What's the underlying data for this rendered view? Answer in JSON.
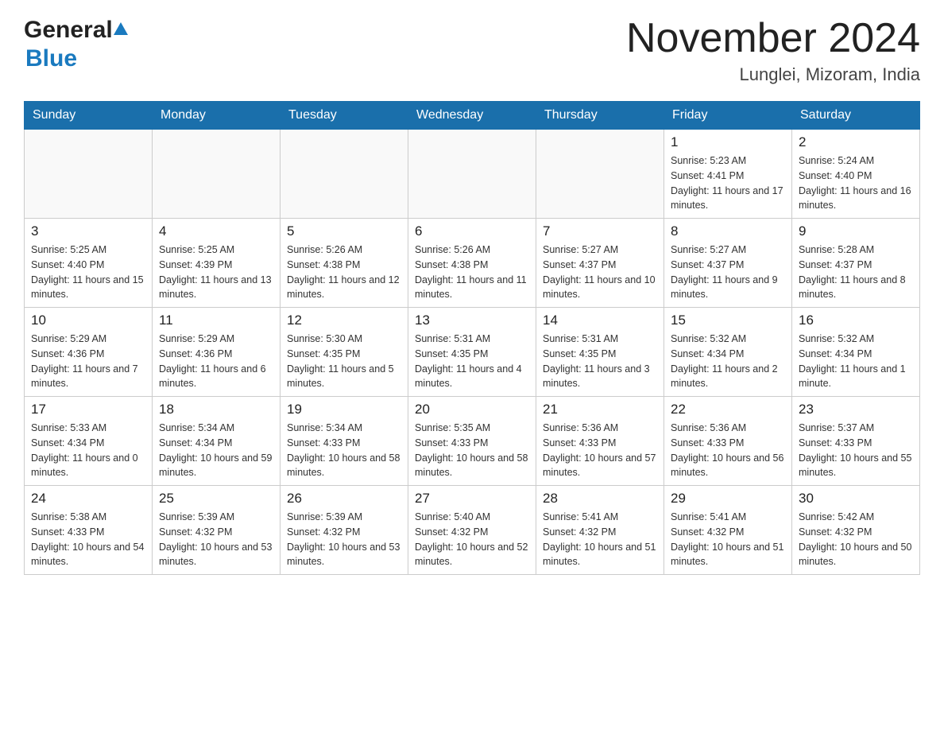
{
  "logo": {
    "general": "General",
    "blue": "Blue"
  },
  "header": {
    "month": "November 2024",
    "location": "Lunglei, Mizoram, India"
  },
  "days_of_week": [
    "Sunday",
    "Monday",
    "Tuesday",
    "Wednesday",
    "Thursday",
    "Friday",
    "Saturday"
  ],
  "weeks": [
    [
      {
        "day": "",
        "info": ""
      },
      {
        "day": "",
        "info": ""
      },
      {
        "day": "",
        "info": ""
      },
      {
        "day": "",
        "info": ""
      },
      {
        "day": "",
        "info": ""
      },
      {
        "day": "1",
        "info": "Sunrise: 5:23 AM\nSunset: 4:41 PM\nDaylight: 11 hours and 17 minutes."
      },
      {
        "day": "2",
        "info": "Sunrise: 5:24 AM\nSunset: 4:40 PM\nDaylight: 11 hours and 16 minutes."
      }
    ],
    [
      {
        "day": "3",
        "info": "Sunrise: 5:25 AM\nSunset: 4:40 PM\nDaylight: 11 hours and 15 minutes."
      },
      {
        "day": "4",
        "info": "Sunrise: 5:25 AM\nSunset: 4:39 PM\nDaylight: 11 hours and 13 minutes."
      },
      {
        "day": "5",
        "info": "Sunrise: 5:26 AM\nSunset: 4:38 PM\nDaylight: 11 hours and 12 minutes."
      },
      {
        "day": "6",
        "info": "Sunrise: 5:26 AM\nSunset: 4:38 PM\nDaylight: 11 hours and 11 minutes."
      },
      {
        "day": "7",
        "info": "Sunrise: 5:27 AM\nSunset: 4:37 PM\nDaylight: 11 hours and 10 minutes."
      },
      {
        "day": "8",
        "info": "Sunrise: 5:27 AM\nSunset: 4:37 PM\nDaylight: 11 hours and 9 minutes."
      },
      {
        "day": "9",
        "info": "Sunrise: 5:28 AM\nSunset: 4:37 PM\nDaylight: 11 hours and 8 minutes."
      }
    ],
    [
      {
        "day": "10",
        "info": "Sunrise: 5:29 AM\nSunset: 4:36 PM\nDaylight: 11 hours and 7 minutes."
      },
      {
        "day": "11",
        "info": "Sunrise: 5:29 AM\nSunset: 4:36 PM\nDaylight: 11 hours and 6 minutes."
      },
      {
        "day": "12",
        "info": "Sunrise: 5:30 AM\nSunset: 4:35 PM\nDaylight: 11 hours and 5 minutes."
      },
      {
        "day": "13",
        "info": "Sunrise: 5:31 AM\nSunset: 4:35 PM\nDaylight: 11 hours and 4 minutes."
      },
      {
        "day": "14",
        "info": "Sunrise: 5:31 AM\nSunset: 4:35 PM\nDaylight: 11 hours and 3 minutes."
      },
      {
        "day": "15",
        "info": "Sunrise: 5:32 AM\nSunset: 4:34 PM\nDaylight: 11 hours and 2 minutes."
      },
      {
        "day": "16",
        "info": "Sunrise: 5:32 AM\nSunset: 4:34 PM\nDaylight: 11 hours and 1 minute."
      }
    ],
    [
      {
        "day": "17",
        "info": "Sunrise: 5:33 AM\nSunset: 4:34 PM\nDaylight: 11 hours and 0 minutes."
      },
      {
        "day": "18",
        "info": "Sunrise: 5:34 AM\nSunset: 4:34 PM\nDaylight: 10 hours and 59 minutes."
      },
      {
        "day": "19",
        "info": "Sunrise: 5:34 AM\nSunset: 4:33 PM\nDaylight: 10 hours and 58 minutes."
      },
      {
        "day": "20",
        "info": "Sunrise: 5:35 AM\nSunset: 4:33 PM\nDaylight: 10 hours and 58 minutes."
      },
      {
        "day": "21",
        "info": "Sunrise: 5:36 AM\nSunset: 4:33 PM\nDaylight: 10 hours and 57 minutes."
      },
      {
        "day": "22",
        "info": "Sunrise: 5:36 AM\nSunset: 4:33 PM\nDaylight: 10 hours and 56 minutes."
      },
      {
        "day": "23",
        "info": "Sunrise: 5:37 AM\nSunset: 4:33 PM\nDaylight: 10 hours and 55 minutes."
      }
    ],
    [
      {
        "day": "24",
        "info": "Sunrise: 5:38 AM\nSunset: 4:33 PM\nDaylight: 10 hours and 54 minutes."
      },
      {
        "day": "25",
        "info": "Sunrise: 5:39 AM\nSunset: 4:32 PM\nDaylight: 10 hours and 53 minutes."
      },
      {
        "day": "26",
        "info": "Sunrise: 5:39 AM\nSunset: 4:32 PM\nDaylight: 10 hours and 53 minutes."
      },
      {
        "day": "27",
        "info": "Sunrise: 5:40 AM\nSunset: 4:32 PM\nDaylight: 10 hours and 52 minutes."
      },
      {
        "day": "28",
        "info": "Sunrise: 5:41 AM\nSunset: 4:32 PM\nDaylight: 10 hours and 51 minutes."
      },
      {
        "day": "29",
        "info": "Sunrise: 5:41 AM\nSunset: 4:32 PM\nDaylight: 10 hours and 51 minutes."
      },
      {
        "day": "30",
        "info": "Sunrise: 5:42 AM\nSunset: 4:32 PM\nDaylight: 10 hours and 50 minutes."
      }
    ]
  ]
}
